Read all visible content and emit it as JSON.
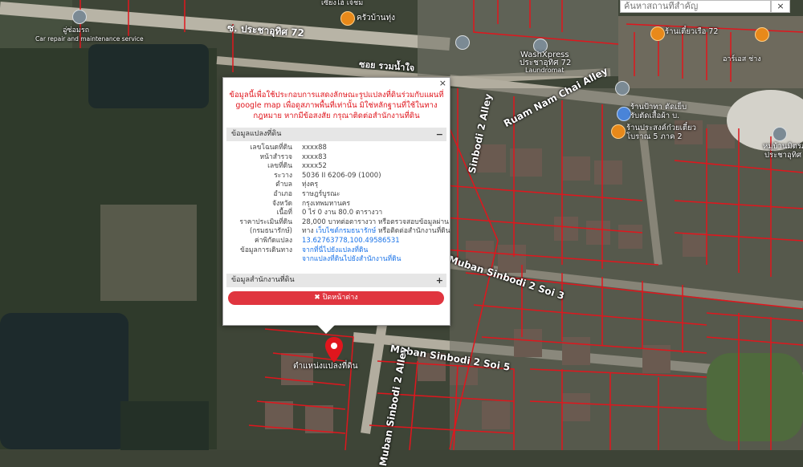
{
  "search": {
    "placeholder": "ค้นหาสถานที่สำคัญ",
    "button_label": "×"
  },
  "map_labels": {
    "road_pracha_uthit": "ซ. ประชาอุทิศ 72",
    "road_ruam_nam": "ซอย รวมน้ำใจ",
    "road_ruam_nam_chai": "Ruam Nam Chai Alley",
    "road_sinbodi_alley": "Sinbodi 2 Alley",
    "road_sinbodi_soi3": "Muban Sinbodi 2 Soi 3",
    "road_sinbodi_soi5": "Muban Sinbodi 2 Soi 5",
    "road_muban_alley": "Muban Sinbodi 2 Alley",
    "poi_car_repair_th": "อู่ซ่อมรถ",
    "poi_car_repair_en": "Car repair and maintenance service",
    "poi_top_center": "เซี่ยงไฮ้ เจ้ชม",
    "poi_restaurant": "ครัวบ้านทุ่ง",
    "poi_washxpress_1": "WashXpress",
    "poi_washxpress_2": "ประชาอุทิศ 72",
    "poi_washxpress_3": "Laundromat",
    "poi_right_1": "ร้านป้าทา ตัดเย็บ",
    "poi_right_2": "รับตัดเสื้อผ้า บ.",
    "poi_right_3": "ร้านประสงค์ก๋วยเตี๋ยว",
    "poi_right_4": "โบราณ 5 ภาค 2",
    "poi_top_right_1": "ร้านเตี๋ยวเรือ 72",
    "poi_top_right_2": "อาร์เอส ช่าง",
    "poi_village_1": "หมู่บ้านมิตรภาพ",
    "poi_village_2": "ประชาอุทิศ",
    "pin_label": "ตำแหน่งแปลงที่ดิน"
  },
  "popup": {
    "close_x": "×",
    "warning": "ข้อมูลนี้เพื่อใช้ประกอบการแสดงลักษณะรูปแปลงที่ดินร่วมกับแผนที่ google map เพื่อดูสภาพพื้นที่เท่านั้น มิใช่หลักฐานที่ใช้ในทางกฎหมาย หากมีข้อสงสัย กรุณาติดต่อสำนักงานที่ดิน",
    "section1_title": "ข้อมูลแปลงที่ดิน",
    "section1_toggle": "−",
    "rows": [
      {
        "label": "เลขโฉนดที่ดิน",
        "value": "xxxx88"
      },
      {
        "label": "หน้าสำรวจ",
        "value": "xxxx83"
      },
      {
        "label": "เลขที่ดิน",
        "value": "xxxx52"
      },
      {
        "label": "ระวาง",
        "value": "5036 II 6206-09 (1000)"
      },
      {
        "label": "ตำบล",
        "value": "ทุ่งครุ"
      },
      {
        "label": "อำเภอ",
        "value": "ราษฎร์บูรณะ"
      },
      {
        "label": "จังหวัด",
        "value": "กรุงเทพมหานคร"
      },
      {
        "label": "เนื้อที่",
        "value": "0 ไร่ 0 งาน 80.0 ตารางวา"
      },
      {
        "label": "ราคาประเมินที่ดิน",
        "value": "28,000 บาทต่อตารางวา หรือตรวจสอบข้อมูลผ่าน"
      },
      {
        "label": "(กรมธนารักษ์)",
        "value_pre": "ทาง ",
        "value_link": "เว็บไซต์กรมธนารักษ์",
        "value_post": " หรือติดต่อสำนักงานที่ดิน"
      },
      {
        "label": "ค่าพิกัดแปลง",
        "value_link": "13.62763778,100.49586531"
      },
      {
        "label": "ข้อมูลการเดินทาง",
        "value_link": "จากที่นี่ไปยังแปลงที่ดิน"
      },
      {
        "label": "",
        "value_link": "จากแปลงที่ดินไปยังสำนักงานที่ดิน"
      }
    ],
    "section2_title": "ข้อมูลสำนักงานที่ดิน",
    "section2_toggle": "+",
    "close_button": "✖ ปิดหน้าต่าง"
  },
  "colors": {
    "parcel_line": "#e0161d",
    "close_button": "#e0353f",
    "link": "#1a73e8",
    "warning_text": "#e0161d"
  }
}
